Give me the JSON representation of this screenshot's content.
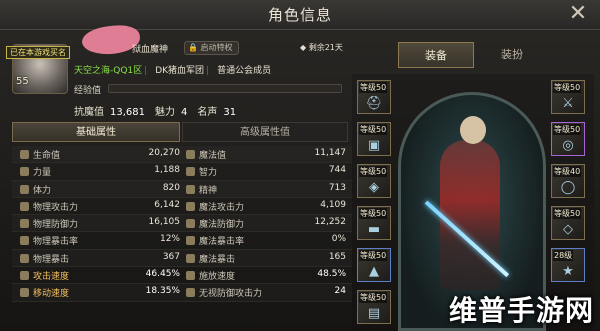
{
  "window": {
    "title": "角色信息",
    "close_glyph": "✕"
  },
  "profile": {
    "level": "55",
    "vip_banner": "已在本游戏买名",
    "job": "狱血魔神",
    "auto_badge": "启动特权",
    "remain": "剩余21天",
    "server": "天空之海-QQ1区",
    "guild": "DK猪血军团",
    "rank": "普通公会成员",
    "exp_label": "经验值",
    "exp_fraction": 0.0,
    "anti_magic_label": "抗魔值",
    "anti_magic_value": "13,681",
    "charm_label": "魅力",
    "charm_value": "4",
    "reputation_label": "名声",
    "reputation_value": "31"
  },
  "tabs": {
    "basic": "基础属性",
    "advanced": "高级属性值"
  },
  "stats": [
    {
      "l_name": "生命值",
      "l_val": "20,270",
      "r_name": "魔法值",
      "r_val": "11,147"
    },
    {
      "l_name": "力量",
      "l_val": "1,188",
      "r_name": "智力",
      "r_val": "744"
    },
    {
      "l_name": "体力",
      "l_val": "820",
      "r_name": "精神",
      "r_val": "713"
    },
    {
      "l_name": "物理攻击力",
      "l_val": "6,142",
      "r_name": "魔法攻击力",
      "r_val": "4,109"
    },
    {
      "l_name": "物理防御力",
      "l_val": "16,105",
      "r_name": "魔法防御力",
      "r_val": "12,252"
    },
    {
      "l_name": "物理暴击率",
      "l_val": "12%",
      "r_name": "魔法暴击率",
      "r_val": "0%"
    },
    {
      "l_name": "物理暴击",
      "l_val": "367",
      "r_name": "魔法暴击",
      "r_val": "165"
    },
    {
      "l_name": "攻击速度",
      "l_val": "46.45%",
      "r_name": "施放速度",
      "r_val": "48.5%"
    },
    {
      "l_name": "移动速度",
      "l_val": "18.35%",
      "r_name": "无视防御攻击力",
      "r_val": "24"
    }
  ],
  "equip_tabs": {
    "equip": "装备",
    "outfit": "装扮"
  },
  "slots_left": [
    {
      "label": "等级50",
      "icon": "helmet-icon"
    },
    {
      "label": "等级50",
      "icon": "chest-icon"
    },
    {
      "label": "等级50",
      "icon": "shoulder-icon"
    },
    {
      "label": "等级50",
      "icon": "belt-icon"
    },
    {
      "label": "等级50",
      "icon": "boots-icon"
    },
    {
      "label": "等级50",
      "icon": "pants-icon"
    }
  ],
  "slots_right": [
    {
      "label": "等级50",
      "icon": "weapon-icon"
    },
    {
      "label": "等级50",
      "icon": "necklace-icon"
    },
    {
      "label": "等级40",
      "icon": "bracelet-icon"
    },
    {
      "label": "等级50",
      "icon": "ring-icon"
    },
    {
      "label": "28级",
      "icon": "title-icon"
    }
  ],
  "watermark": "维普手游网"
}
